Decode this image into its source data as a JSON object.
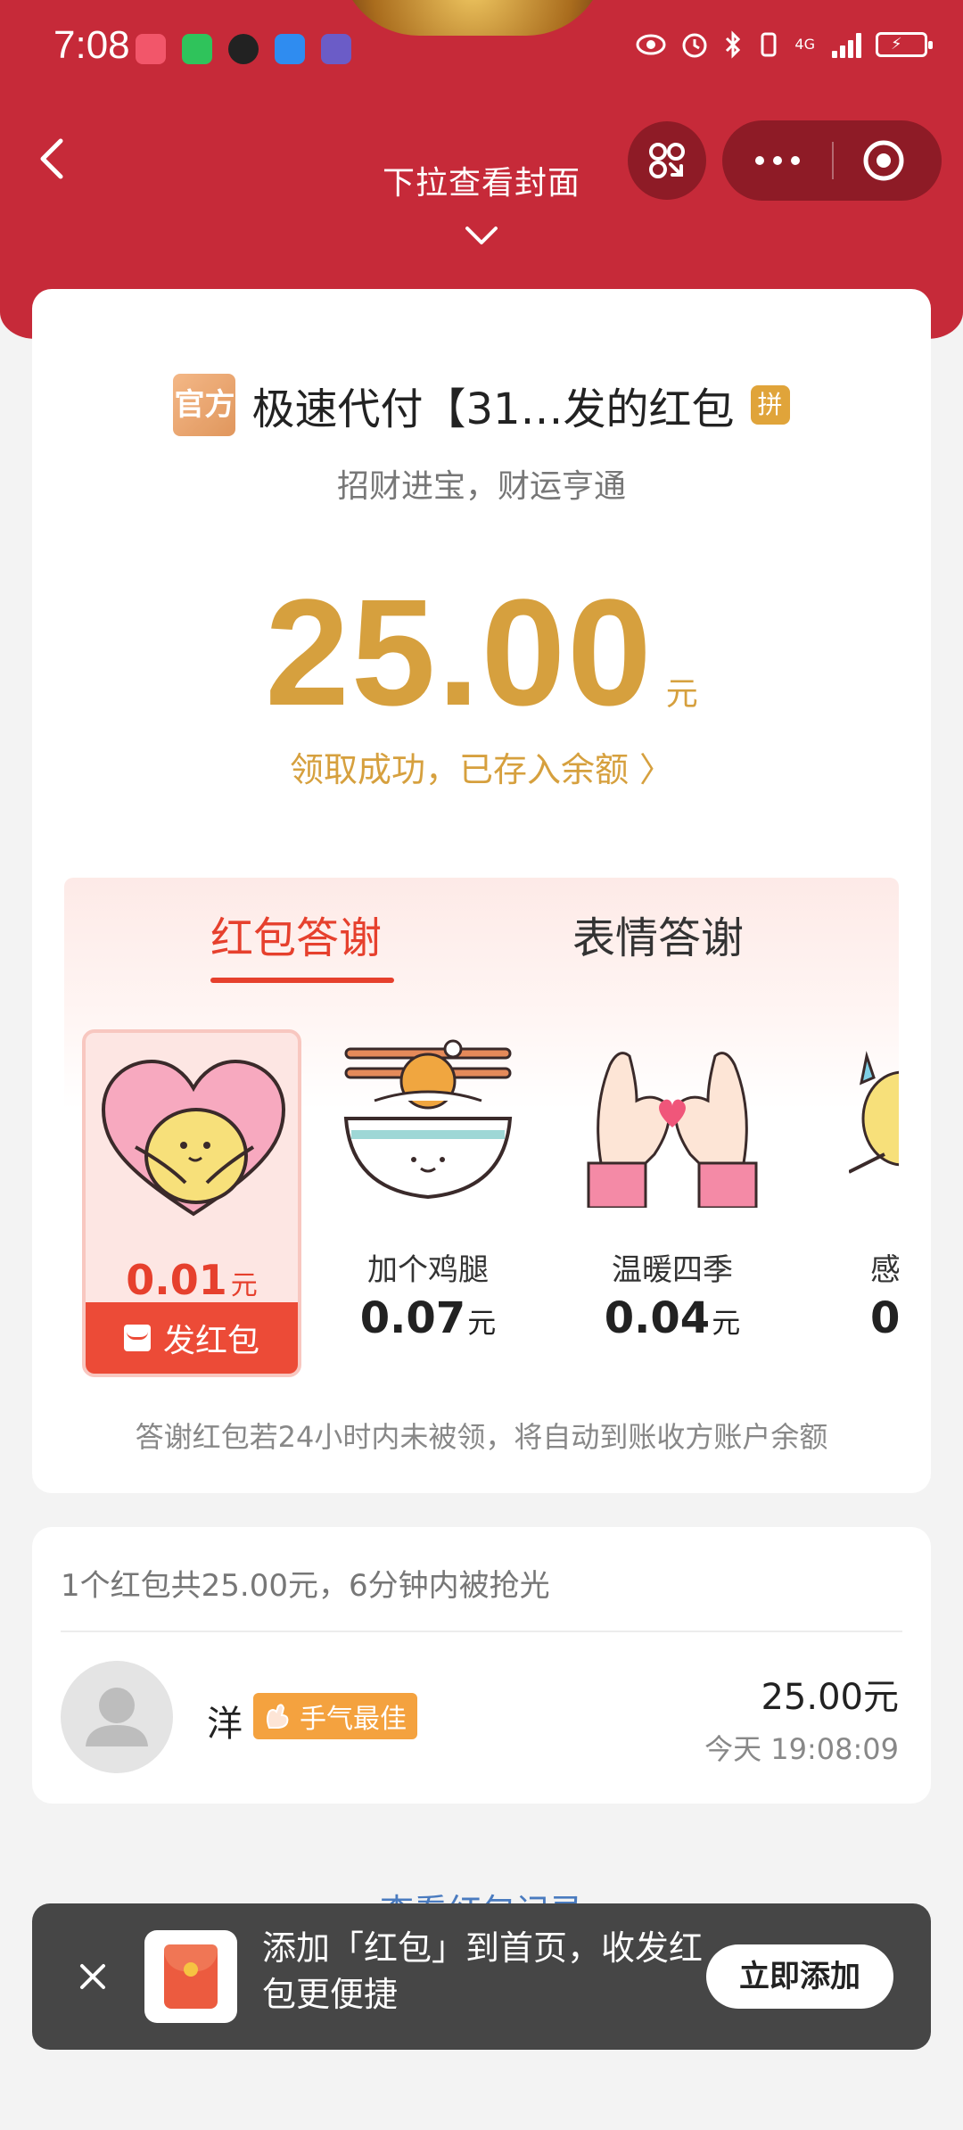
{
  "statusbar": {
    "time": "7:08",
    "network": "4G"
  },
  "header": {
    "pull_hint": "下拉查看封面"
  },
  "sender": {
    "official_badge": "官方",
    "name": "极速代付【31…发的红包",
    "pin_tag": "拼",
    "wish": "招财进宝，财运亨通"
  },
  "amount": {
    "value": "25.00",
    "unit": "元"
  },
  "deposit_text": "领取成功，已存入余额 〉",
  "thanks": {
    "tabs": [
      {
        "label": "红包答谢",
        "active": true
      },
      {
        "label": "表情答谢",
        "active": false
      }
    ],
    "selected": {
      "price": "0.01",
      "unit": "元",
      "send_label": "发红包"
    },
    "stickers": [
      {
        "label": "加个鸡腿",
        "price": "0.07",
        "unit": "元"
      },
      {
        "label": "温暖四季",
        "price": "0.04",
        "unit": "元"
      },
      {
        "label": "感",
        "price": "0",
        "unit": ""
      }
    ],
    "note": "答谢红包若24小时内未被领，将自动到账收方账户余额"
  },
  "receivers": {
    "summary": "1个红包共25.00元，6分钟内被抢光",
    "items": [
      {
        "name": "洋",
        "tag": "手气最佳",
        "amount": "25.00元",
        "time": "今天 19:08:09"
      }
    ]
  },
  "view_record": "查看红包记录",
  "toast": {
    "text": "添加「红包」到首页，收发红包更便捷",
    "button": "立即添加"
  },
  "colors": {
    "header_red": "#c62a39",
    "gold": "#d6a03e",
    "accent_red": "#e6402d",
    "best_tag": "#f4a23f"
  }
}
